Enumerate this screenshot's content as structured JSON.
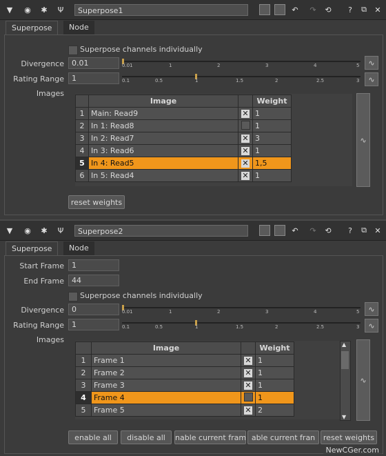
{
  "panels": [
    {
      "node_name": "Superpose1",
      "tabs": [
        "Superpose",
        "Node"
      ],
      "channels_label": "Superpose channels individually",
      "divergence_label": "Divergence",
      "divergence_value": "0.01",
      "divergence_ticks": [
        "0.01",
        "1",
        "2",
        "3",
        "4",
        "5"
      ],
      "rating_label": "Rating Range",
      "rating_value": "1",
      "rating_ticks": [
        "0.1",
        "0.5",
        "1",
        "1.5",
        "2",
        "2.5",
        "3"
      ],
      "images_label": "Images",
      "table_headers": [
        "Image",
        "Weight"
      ],
      "rows": [
        {
          "idx": "1",
          "image": "Main: Read9",
          "checked": true,
          "weight": "1",
          "selected": false
        },
        {
          "idx": "2",
          "image": "In 1: Read8",
          "checked": false,
          "weight": "1",
          "selected": false
        },
        {
          "idx": "3",
          "image": "In 2: Read7",
          "checked": true,
          "weight": "3",
          "selected": false
        },
        {
          "idx": "4",
          "image": "In 3: Read6",
          "checked": true,
          "weight": "1",
          "selected": false
        },
        {
          "idx": "5",
          "image": "In 4: Read5",
          "checked": true,
          "weight": "1,5",
          "selected": true
        },
        {
          "idx": "6",
          "image": "In 5: Read4",
          "checked": true,
          "weight": "1",
          "selected": false
        }
      ],
      "buttons": [
        "reset weights"
      ]
    },
    {
      "node_name": "Superpose2",
      "tabs": [
        "Superpose",
        "Node"
      ],
      "start_frame_label": "Start Frame",
      "start_frame_value": "1",
      "end_frame_label": "End Frame",
      "end_frame_value": "44",
      "channels_label": "Superpose channels individually",
      "divergence_label": "Divergence",
      "divergence_value": "0",
      "divergence_ticks": [
        "0.01",
        "1",
        "2",
        "3",
        "4",
        "5"
      ],
      "rating_label": "Rating Range",
      "rating_value": "1",
      "rating_ticks": [
        "0.1",
        "0.5",
        "1",
        "1.5",
        "2",
        "2.5",
        "3"
      ],
      "images_label": "Images",
      "table_headers": [
        "Image",
        "Weight"
      ],
      "rows": [
        {
          "idx": "1",
          "image": "Frame 1",
          "checked": true,
          "weight": "1",
          "selected": false
        },
        {
          "idx": "2",
          "image": "Frame 2",
          "checked": true,
          "weight": "1",
          "selected": false
        },
        {
          "idx": "3",
          "image": "Frame 3",
          "checked": true,
          "weight": "1",
          "selected": false
        },
        {
          "idx": "4",
          "image": "Frame 4",
          "checked": false,
          "weight": "1",
          "selected": true
        },
        {
          "idx": "5",
          "image": "Frame 5",
          "checked": true,
          "weight": "2",
          "selected": false
        }
      ],
      "buttons": [
        "enable all",
        "disable all",
        "nable current fram",
        "able current fran",
        "reset weights"
      ]
    }
  ],
  "watermark": "NewCGer.com",
  "colors": {
    "selection": "#f0961b",
    "panel_bg": "#3b3b3b",
    "slider_handle": "#c9a04a"
  }
}
